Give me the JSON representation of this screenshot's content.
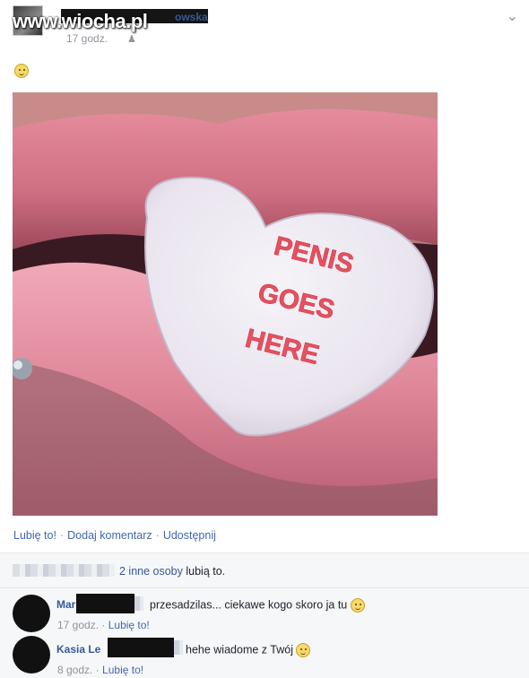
{
  "watermark": "www.wiocha.pl",
  "post": {
    "author_visible": "owska",
    "time": "17 godz.",
    "audience_icon": "friends-icon",
    "menu_icon": "chevron-down-icon",
    "emoji": "smile-emoji",
    "heart_text": [
      "PENIS",
      "GOES",
      "HERE"
    ]
  },
  "actions": {
    "like": "Lubię to!",
    "comment": "Dodaj komentarz",
    "share": "Udostępnij",
    "separator": "·"
  },
  "likes": {
    "count_text": "2 inne osoby",
    "suffix": "lubią to."
  },
  "comments": [
    {
      "name": "Mar",
      "text": "przesadzilas... ciekawe kogo skoro ja tu",
      "time": "17 godz.",
      "like": "Lubię to!"
    },
    {
      "name": "Kasia Le",
      "text": "hehe wiadome z Twój",
      "time": "8 godz.",
      "like": "Lubię to!"
    }
  ],
  "colors": {
    "link": "#4267b2",
    "name": "#365899",
    "meta": "#90949c",
    "lips": "#d97a8e",
    "heart_text": "#e8505f"
  }
}
